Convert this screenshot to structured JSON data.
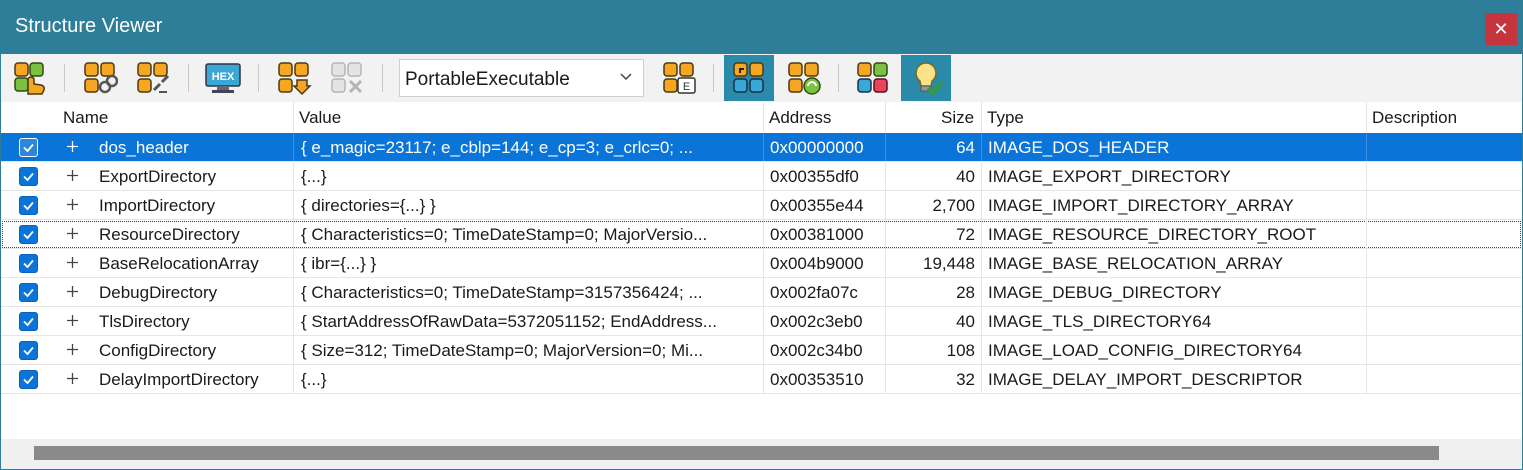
{
  "window": {
    "title": "Structure Viewer",
    "close_symbol": "✕"
  },
  "toolbar": {
    "format_select": {
      "value": "PortableExecutable"
    },
    "icons": {
      "tb1": "structure-hand-icon",
      "tb2": "structure-link-icon",
      "tb3": "structure-unlink-icon",
      "tb4": "hex-view-icon",
      "tb5": "structure-download-icon",
      "tb6": "structure-disabled-icon",
      "tb7": "structure-edit-e-icon",
      "tb8": "structure-refresh-icon",
      "tb9": "structure-sync-icon",
      "tb10": "structure-color-icon",
      "tb11": "lightbulb-check-icon"
    },
    "hex_label": "HEX",
    "edit_label": "E"
  },
  "columns": {
    "name": "Name",
    "value": "Value",
    "address": "Address",
    "size": "Size",
    "type": "Type",
    "description": "Description"
  },
  "rows": [
    {
      "name": "dos_header",
      "value": "{ e_magic=23117; e_cblp=144; e_cp=3; e_crlc=0; ...",
      "address": "0x00000000",
      "size": "64",
      "type": "IMAGE_DOS_HEADER",
      "description": ""
    },
    {
      "name": "ExportDirectory",
      "value": "{...}",
      "address": "0x00355df0",
      "size": "40",
      "type": "IMAGE_EXPORT_DIRECTORY",
      "description": ""
    },
    {
      "name": "ImportDirectory",
      "value": "{ directories={...} }",
      "address": "0x00355e44",
      "size": "2,700",
      "type": "IMAGE_IMPORT_DIRECTORY_ARRAY",
      "description": ""
    },
    {
      "name": "ResourceDirectory",
      "value": "{ Characteristics=0; TimeDateStamp=0; MajorVersio...",
      "address": "0x00381000",
      "size": "72",
      "type": "IMAGE_RESOURCE_DIRECTORY_ROOT",
      "description": ""
    },
    {
      "name": "BaseRelocationArray",
      "value": "{ ibr={...} }",
      "address": "0x004b9000",
      "size": "19,448",
      "type": "IMAGE_BASE_RELOCATION_ARRAY",
      "description": ""
    },
    {
      "name": "DebugDirectory",
      "value": "{ Characteristics=0; TimeDateStamp=3157356424; ...",
      "address": "0x002fa07c",
      "size": "28",
      "type": "IMAGE_DEBUG_DIRECTORY",
      "description": ""
    },
    {
      "name": "TlsDirectory",
      "value": "{ StartAddressOfRawData=5372051152; EndAddress...",
      "address": "0x002c3eb0",
      "size": "40",
      "type": "IMAGE_TLS_DIRECTORY64",
      "description": ""
    },
    {
      "name": "ConfigDirectory",
      "value": "{ Size=312; TimeDateStamp=0; MajorVersion=0; Mi...",
      "address": "0x002c34b0",
      "size": "108",
      "type": "IMAGE_LOAD_CONFIG_DIRECTORY64",
      "description": ""
    },
    {
      "name": "DelayImportDirectory",
      "value": "{...}",
      "address": "0x00353510",
      "size": "32",
      "type": "IMAGE_DELAY_IMPORT_DESCRIPTOR",
      "description": ""
    }
  ],
  "selected_row": 0,
  "focused_row": 3,
  "colors": {
    "titlebar": "#2e7e9a",
    "selection": "#0a74d8",
    "close_button": "#c6343d",
    "toolbar_active": "#2a8aaa",
    "icon_orange": "#f5a623",
    "icon_green": "#7cc242"
  }
}
